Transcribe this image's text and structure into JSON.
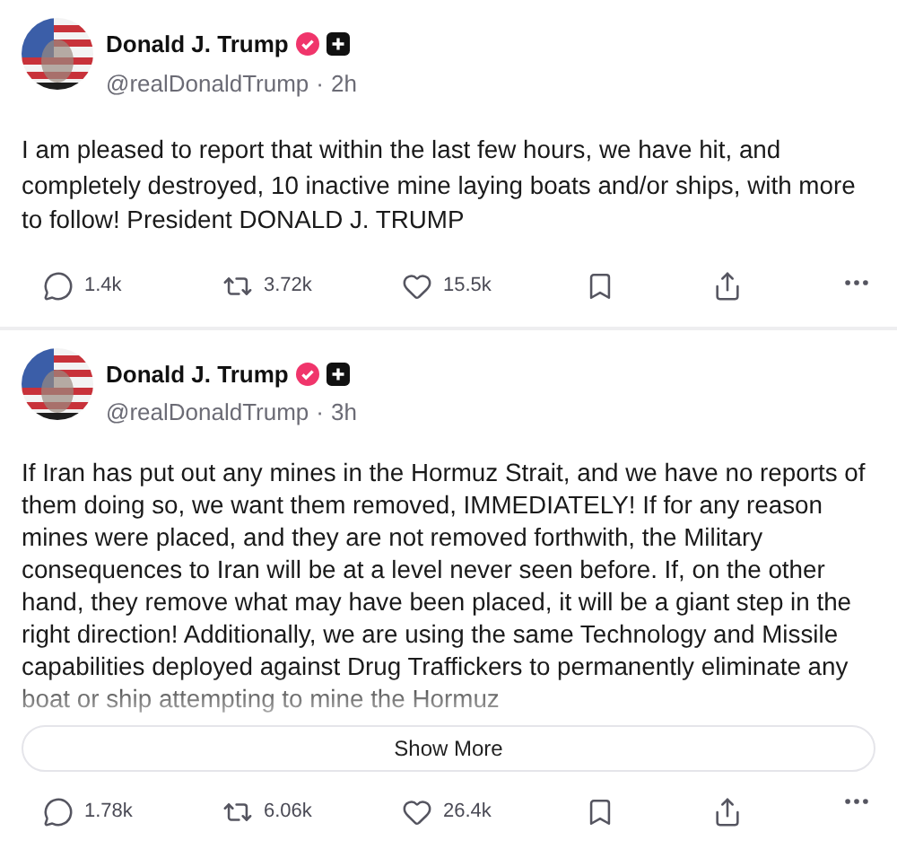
{
  "posts": [
    {
      "author": "Donald J. Trump",
      "verified": true,
      "handle": "@realDonaldTrump",
      "separator": "·",
      "time": "2h",
      "text": "I am pleased to report that within the last few hours, we have hit, and completely destroyed, 10 inactive mine laying boats and/or ships, with more to follow! President DONALD J. TRUMP",
      "truncated": false,
      "replies": "1.4k",
      "reposts": "3.72k",
      "likes": "15.5k"
    },
    {
      "author": "Donald J. Trump",
      "verified": true,
      "handle": "@realDonaldTrump",
      "separator": "·",
      "time": "3h",
      "text": "If Iran has put out any mines in the Hormuz Strait, and we have no reports of them doing so, we want them removed, IMMEDIATELY! If for any reason mines were placed, and they are not removed forthwith, the Military consequences to Iran will be at a level never seen before. If, on the other hand, they remove what may have been placed, it will be a giant step in the right direction! Additionally, we are using the same Technology and Missile capabilities deployed against Drug Traffickers to permanently eliminate any boat or ship attempting to mine the Hormuz",
      "truncated": true,
      "show_more": "Show More",
      "replies": "1.78k",
      "reposts": "6.06k",
      "likes": "26.4k"
    }
  ]
}
